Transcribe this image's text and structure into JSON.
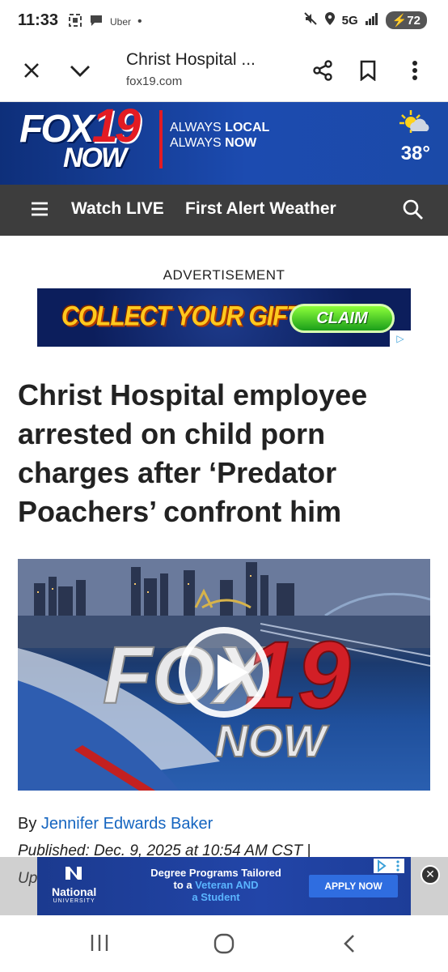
{
  "status_bar": {
    "time": "11:33",
    "notif_label": "Uber",
    "network": "5G",
    "battery": "72"
  },
  "browser": {
    "title": "Christ Hospital ...",
    "url": "fox19.com",
    "icons": [
      "close-icon",
      "chevron-down-icon",
      "share-icon",
      "bookmark-icon",
      "more-vert-icon"
    ]
  },
  "site_header": {
    "logo_word": "FOX",
    "logo_number": "19",
    "logo_sub": "NOW",
    "tagline_1_a": "ALWAYS ",
    "tagline_1_b": "LOCAL",
    "tagline_2_a": "ALWAYS ",
    "tagline_2_b": "NOW",
    "temperature": "38°",
    "weather_icon": "partly-cloudy-icon"
  },
  "nav": {
    "watch_live": "Watch LIVE",
    "weather": "First Alert Weather"
  },
  "ad_top": {
    "label": "ADVERTISEMENT",
    "text": "COLLECT YOUR GIFT!",
    "cta": "CLAIM"
  },
  "article": {
    "headline": "Christ Hospital employee arrested on child porn charges after ‘Predator Poachers’ confront him",
    "video_logo_word": "FOX",
    "video_logo_number": "19",
    "video_logo_sub": "NOW",
    "byline_prefix": "By ",
    "author": "Jennifer Edwards Baker",
    "published": "Published: Dec. 9, 2025 at 10:54 AM CST  |",
    "updated": "Up"
  },
  "ad_bottom": {
    "brand": "National",
    "brand_sub": "UNIVERSITY",
    "copy_1": "Degree Programs Tailored",
    "copy_2a": "to a ",
    "copy_2b": "Veteran AND",
    "copy_3": "a Student",
    "cta": "APPLY NOW"
  },
  "colors": {
    "fox_blue": "#1c4bb0",
    "fox_red": "#e31b23",
    "nav_bg": "#3d3d3d",
    "link": "#1565c0"
  }
}
